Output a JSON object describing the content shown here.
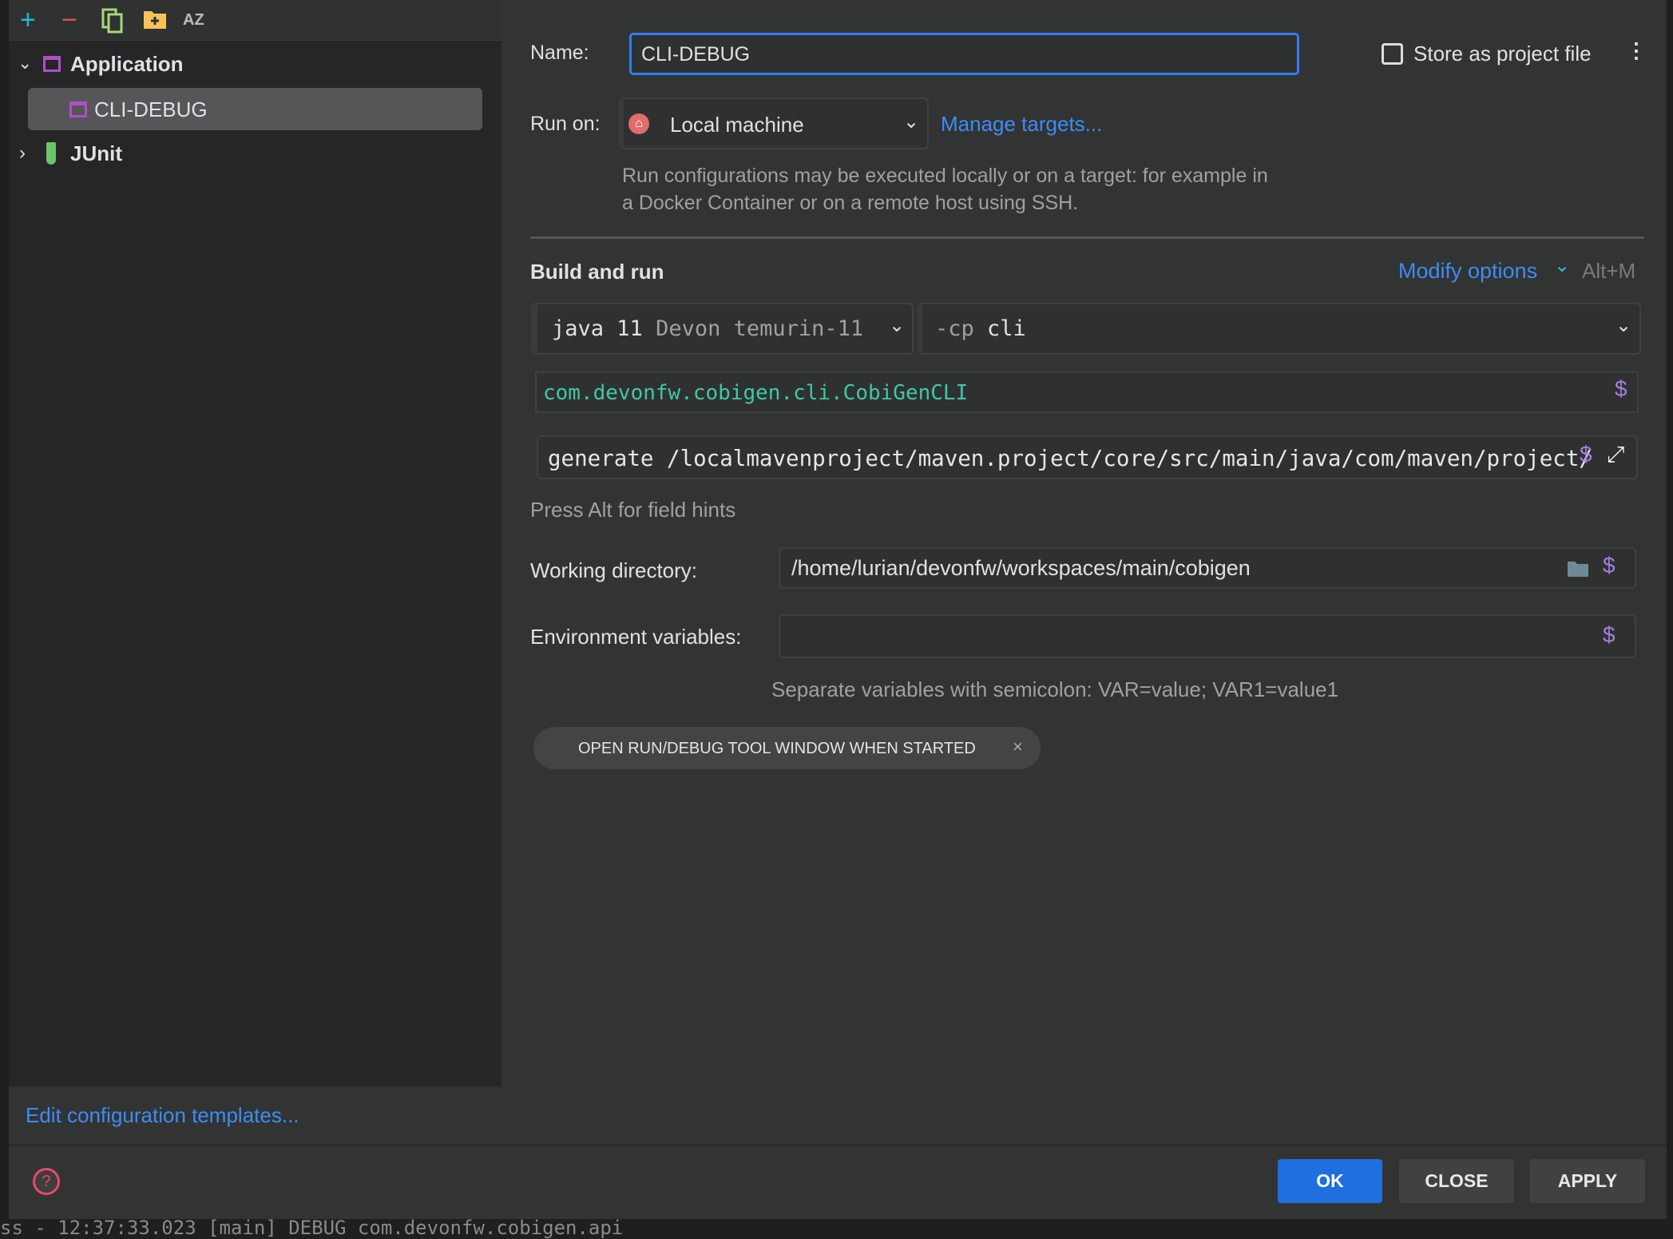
{
  "toolbar": {
    "icons": [
      "plus-icon",
      "minus-icon",
      "copy-icon",
      "folder-add-icon",
      "sort-az-icon"
    ],
    "sort_label": "AZ"
  },
  "tree": {
    "groups": [
      {
        "label": "Application",
        "expanded": true,
        "children": [
          {
            "label": "CLI-DEBUG",
            "selected": true
          }
        ]
      },
      {
        "label": "JUnit",
        "expanded": false
      }
    ]
  },
  "edit_templates_link": "Edit configuration templates...",
  "form": {
    "name_label": "Name:",
    "name_value": "CLI-DEBUG",
    "store_label": "Store as project file",
    "store_checked": false,
    "run_on_label": "Run on:",
    "run_on_value": "Local machine",
    "manage_targets": "Manage targets...",
    "run_on_desc_1": "Run configurations may be executed locally or on a target: for example in",
    "run_on_desc_2": "a Docker Container or on a remote host using SSH.",
    "build_run_title": "Build and run",
    "modify_options": "Modify options",
    "modify_shortcut": "Alt+M",
    "jdk_main": "java 11",
    "jdk_detail": "Devon temurin-11",
    "cp_prefix": "-cp",
    "cp_value": "cli",
    "main_class": "com.devonfw.cobigen.cli.CobiGenCLI",
    "program_args": "generate /localmavenproject/maven.project/core/src/main/java/com/maven/project/",
    "field_hint": "Press Alt for field hints",
    "working_dir_label": "Working directory:",
    "working_dir_value": "/home/lurian/devonfw/workspaces/main/cobigen",
    "env_label": "Environment variables:",
    "env_value": "",
    "env_hint": "Separate variables with semicolon: VAR=value; VAR1=value1",
    "chip_label": "OPEN RUN/DEBUG TOOL WINDOW WHEN STARTED"
  },
  "buttons": {
    "ok": "OK",
    "close": "CLOSE",
    "apply": "APPLY"
  },
  "background_log": "ss - 12:37:33.023 [main] DEBUG com.devonfw.cobigen.api",
  "colors": {
    "accent": "#1f6fe0",
    "link": "#3d8cf7",
    "macro": "#a77de0",
    "main_class": "#3fc7a7"
  }
}
